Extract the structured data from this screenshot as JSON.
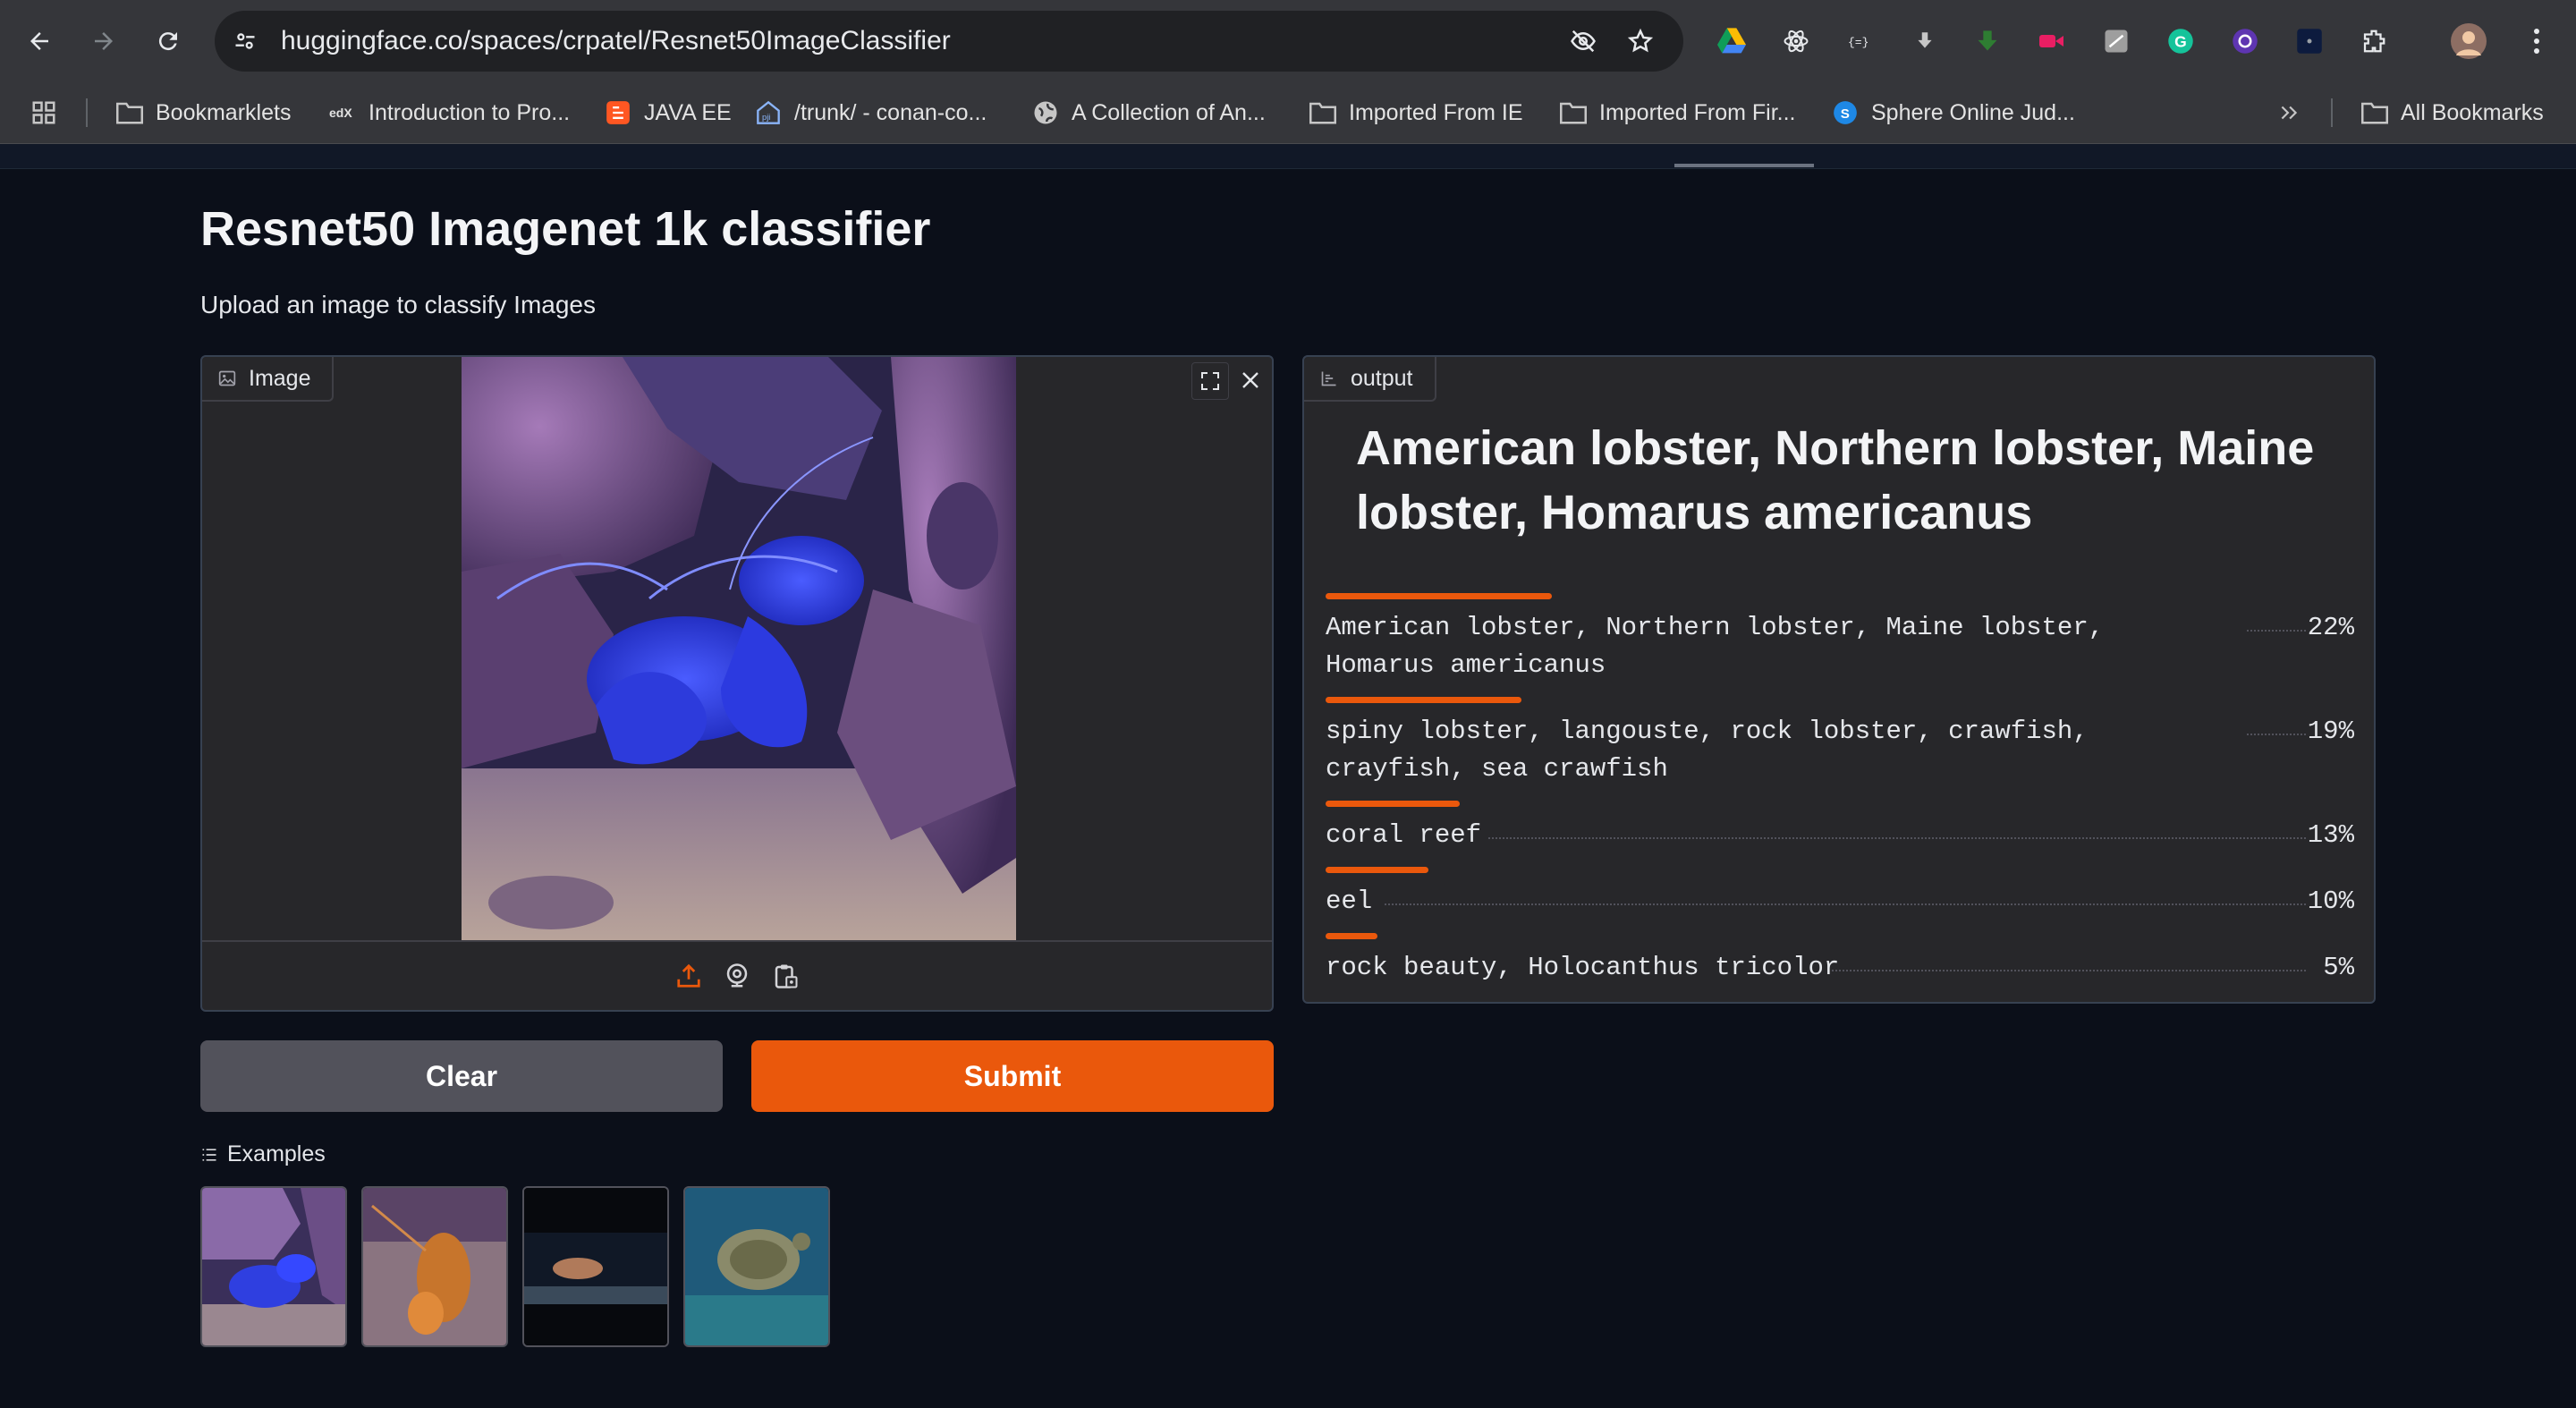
{
  "browser": {
    "url": "huggingface.co/spaces/crpatel/Resnet50ImageClassifier",
    "bookmarks": [
      {
        "label": "Bookmarklets",
        "icon": "folder-icon"
      },
      {
        "label": "Introduction to Pro...",
        "icon": "edx-icon"
      },
      {
        "label": "JAVA EE",
        "icon": "blogger-icon"
      },
      {
        "label": "/trunk/ - conan-co...",
        "icon": "pji-icon"
      },
      {
        "label": "A Collection of An...",
        "icon": "globe-icon"
      },
      {
        "label": "Imported From IE",
        "icon": "folder-icon"
      },
      {
        "label": "Imported From Fir...",
        "icon": "folder-icon"
      },
      {
        "label": "Sphere Online Jud...",
        "icon": "spoj-icon"
      }
    ],
    "all_bookmarks": "All Bookmarks"
  },
  "app": {
    "title": "Resnet50 Imagenet 1k classifier",
    "description": "Upload an image to classify Images"
  },
  "input": {
    "label": "Image"
  },
  "output": {
    "label": "output",
    "top_label": "American lobster, Northern lobster, Maine lobster, Homarus americanus",
    "confidences": [
      {
        "label": "American lobster, Northern lobster, Maine lobster, Homarus americanus",
        "pct": "22%",
        "value": 0.22
      },
      {
        "label": "spiny lobster, langouste, rock lobster, crawfish, crayfish, sea crawfish",
        "pct": "19%",
        "value": 0.19
      },
      {
        "label": "coral reef",
        "pct": "13%",
        "value": 0.13
      },
      {
        "label": "eel",
        "pct": "10%",
        "value": 0.1
      },
      {
        "label": "rock beauty, Holocanthus tricolor",
        "pct": "5%",
        "value": 0.05
      }
    ]
  },
  "buttons": {
    "clear": "Clear",
    "submit": "Submit"
  },
  "examples": {
    "label": "Examples"
  },
  "colors": {
    "accent": "#ea580c",
    "background": "#0b0f19",
    "panel": "#27272a"
  }
}
